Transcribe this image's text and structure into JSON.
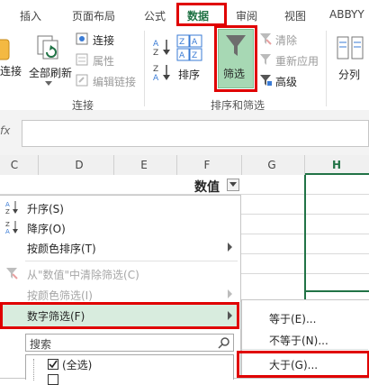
{
  "tabs": [
    {
      "label": "插入"
    },
    {
      "label": "页面布局"
    },
    {
      "label": "公式"
    },
    {
      "label": "数据"
    },
    {
      "label": "审阅"
    },
    {
      "label": "视图"
    },
    {
      "label": "ABBYY"
    }
  ],
  "ribbon": {
    "connections_group": {
      "refresh_all_label": "全部刷新",
      "partial_left_label": "连接",
      "connections": "连接",
      "properties": "属性",
      "edit_links": "编辑链接",
      "group_label": "连接"
    },
    "sort_filter_group": {
      "sort_label": "排序",
      "filter_label": "筛选",
      "clear": "清除",
      "reapply": "重新应用",
      "advanced": "高级",
      "group_label": "排序和筛选"
    },
    "data_tools": {
      "split_label": "分列"
    }
  },
  "formula_bar": {
    "fx": "fx",
    "value": ""
  },
  "columns": [
    "C",
    "D",
    "E",
    "F",
    "G",
    "H"
  ],
  "header_cell": {
    "text": "数值"
  },
  "menu": {
    "items": [
      {
        "label": "升序(S)",
        "disabled": false
      },
      {
        "label": "降序(O)",
        "disabled": false
      },
      {
        "label": "按颜色排序(T)",
        "disabled": false
      },
      {
        "label": "从\"数值\"中清除筛选(C)",
        "disabled": true
      },
      {
        "label": "按颜色筛选(I)",
        "disabled": true
      },
      {
        "label": "数字筛选(F)",
        "disabled": false
      }
    ],
    "search_placeholder": "搜索",
    "select_all": "(全选)"
  },
  "submenu": {
    "items": [
      {
        "label": "等于(E)..."
      },
      {
        "label": "不等于(N)..."
      },
      {
        "label": "大于(G)..."
      }
    ]
  },
  "colors": {
    "accent_green": "#217346",
    "highlight_red": "#e00000",
    "filter_active_bg": "#a7d8b4",
    "menu_hover_bg": "#d8ecde"
  }
}
